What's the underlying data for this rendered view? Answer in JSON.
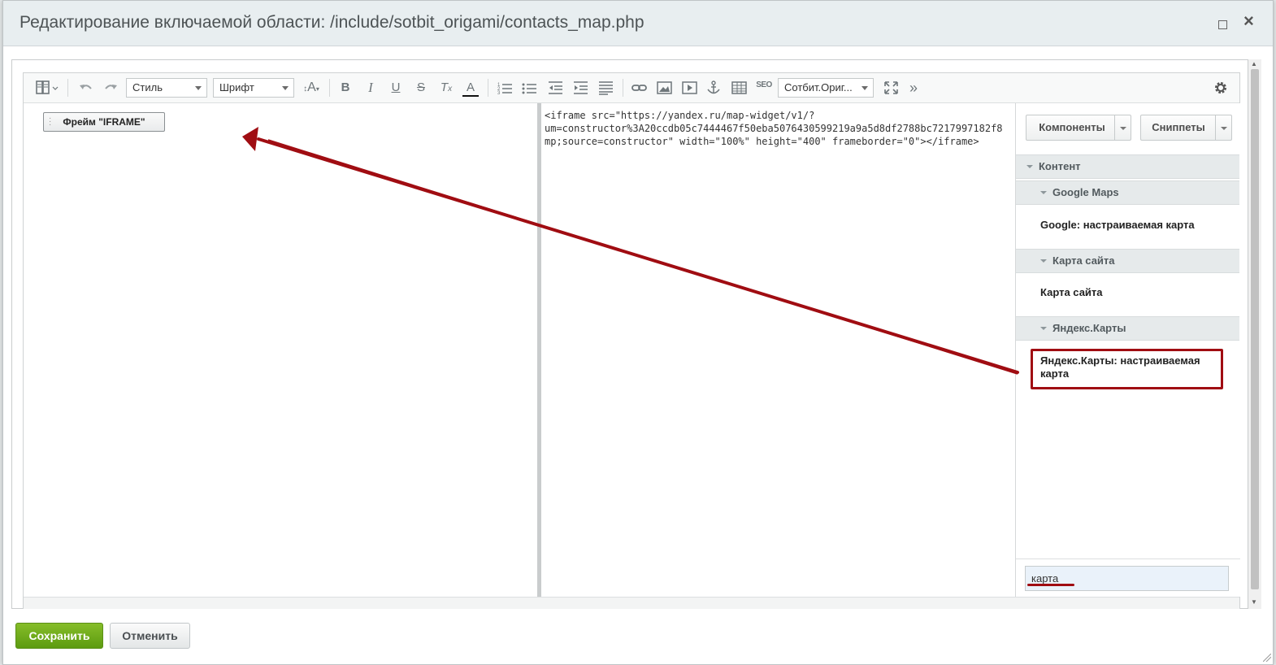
{
  "dialog": {
    "title": "Редактирование включаемой области: /include/sotbit_origami/contacts_map.php"
  },
  "toolbar": {
    "style_select": "Стиль",
    "font_select": "Шрифт",
    "font_size_glyph": "A",
    "bold": "B",
    "italic": "I",
    "underline": "U",
    "strike": "S",
    "clear_format": "T",
    "font_color": "A",
    "seo": "SEO",
    "template_select": "Сотбит.Ориг...",
    "more": "»"
  },
  "editor": {
    "iframe_chip": "Фрейм \"IFRAME\"",
    "code_lines": [
      "<iframe src=\"https://yandex.ru/map-widget/v1/?",
      "um=constructor%3A20ccdb05c7444467f50eba5076430599219a9a5d8df2788bc7217997182f8",
      "mp;source=constructor\" width=\"100%\" height=\"400\" frameborder=\"0\"></iframe>"
    ]
  },
  "sidebar": {
    "components_button": "Компоненты",
    "snippets_button": "Сниппеты",
    "sections": [
      {
        "label": "Контент"
      },
      {
        "label": "Google Maps",
        "item": "Google: настраиваемая карта"
      },
      {
        "label": "Карта сайта",
        "item": "Карта сайта"
      },
      {
        "label": "Яндекс.Карты",
        "item": "Яндекс.Карты: настраиваемая карта"
      }
    ],
    "search_value": "карта"
  },
  "footer": {
    "save_label": "Сохранить",
    "cancel_label": "Отменить"
  },
  "colors": {
    "accent_red": "#a00d12",
    "save_green": "#6aa81a"
  }
}
